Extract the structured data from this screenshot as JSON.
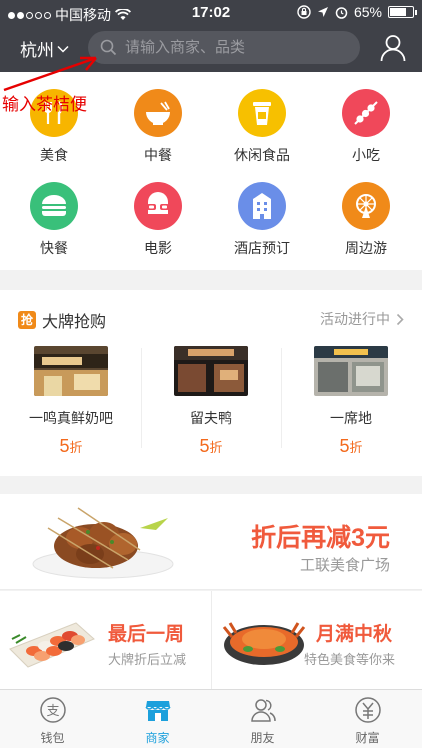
{
  "status_bar": {
    "carrier": "中国移动",
    "time": "17:02",
    "battery": "65%"
  },
  "header": {
    "city": "杭州",
    "search_placeholder": "请输入商家、品类"
  },
  "annotation": {
    "text": "输入茶桔便",
    "color": "#e60000"
  },
  "categories": [
    {
      "label": "美食",
      "icon": "fork-knife-icon",
      "color": "#f7b500"
    },
    {
      "label": "中餐",
      "icon": "bowl-icon",
      "color": "#f08a19"
    },
    {
      "label": "休闲食品",
      "icon": "cup-icon",
      "color": "#f7c000"
    },
    {
      "label": "小吃",
      "icon": "skewer-icon",
      "color": "#f0485a"
    },
    {
      "label": "快餐",
      "icon": "burger-icon",
      "color": "#39c07a"
    },
    {
      "label": "电影",
      "icon": "glasses-icon",
      "color": "#f0485a"
    },
    {
      "label": "酒店预订",
      "icon": "building-icon",
      "color": "#6a8ee8"
    },
    {
      "label": "周边游",
      "icon": "ferris-wheel-icon",
      "color": "#f08a19"
    }
  ],
  "brand_sale": {
    "badge": "抢",
    "title": "大牌抢购",
    "status": "活动进行中",
    "shops": [
      {
        "name": "一鸣真鲜奶吧",
        "discount": "5",
        "unit": "折"
      },
      {
        "name": "留夫鸭",
        "discount": "5",
        "unit": "折"
      },
      {
        "name": "一席地",
        "discount": "5",
        "unit": "折"
      }
    ]
  },
  "promo": {
    "title": "折后再减3元",
    "subtitle": "工联美食广场"
  },
  "deals": [
    {
      "title": "最后一周",
      "subtitle": "大牌折后立减"
    },
    {
      "title": "月满中秋",
      "subtitle": "特色美食等你来"
    }
  ],
  "tabbar": [
    {
      "label": "钱包",
      "icon": "wallet-icon",
      "active": false
    },
    {
      "label": "商家",
      "icon": "store-icon",
      "active": true
    },
    {
      "label": "朋友",
      "icon": "friends-icon",
      "active": false
    },
    {
      "label": "财富",
      "icon": "wealth-icon",
      "active": false
    }
  ],
  "colors": {
    "header_bg": "#3f4148",
    "accent": "#1ca0dc",
    "discount": "#f36a1d",
    "promo_text": "#f05a3c"
  }
}
